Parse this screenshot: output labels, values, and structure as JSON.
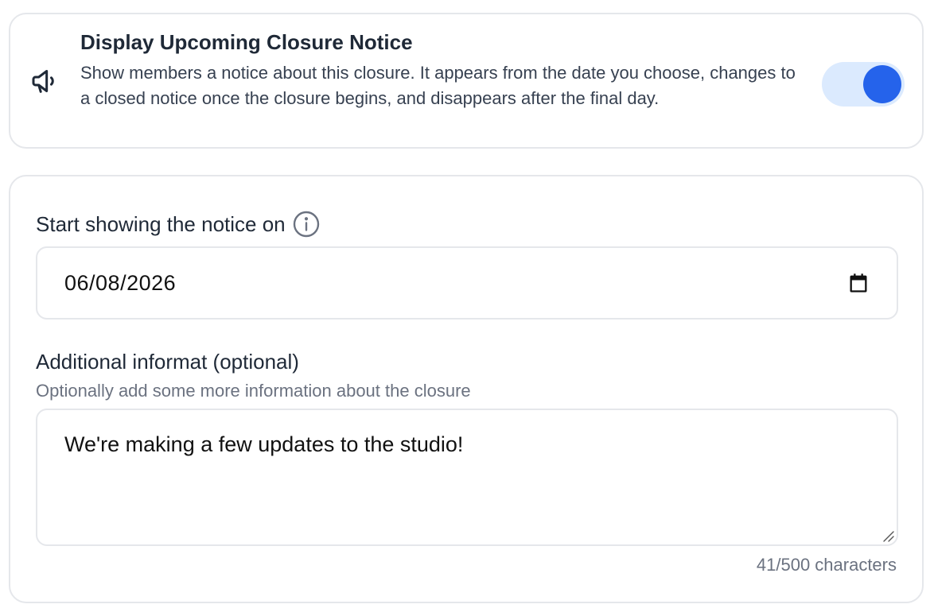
{
  "notice": {
    "icon": "megaphone-icon",
    "title": "Display Upcoming Closure Notice",
    "description": "Show members a notice about this closure. It appears from the date you choose, changes to a closed notice once the closure begins, and disappears after the final day.",
    "toggle_on": true,
    "colors": {
      "toggle_track": "#dbeafe",
      "toggle_knob": "#2563eb"
    }
  },
  "start_date": {
    "label": "Start showing the notice on",
    "info_icon": "info-icon",
    "value": "06/08/2026",
    "calendar_icon": "calendar-icon"
  },
  "additional_info": {
    "label": "Additional informat (optional)",
    "help": "Optionally add some more information about the closure",
    "value": "We're making a few updates to the studio!",
    "char_count": "41/500 characters"
  }
}
